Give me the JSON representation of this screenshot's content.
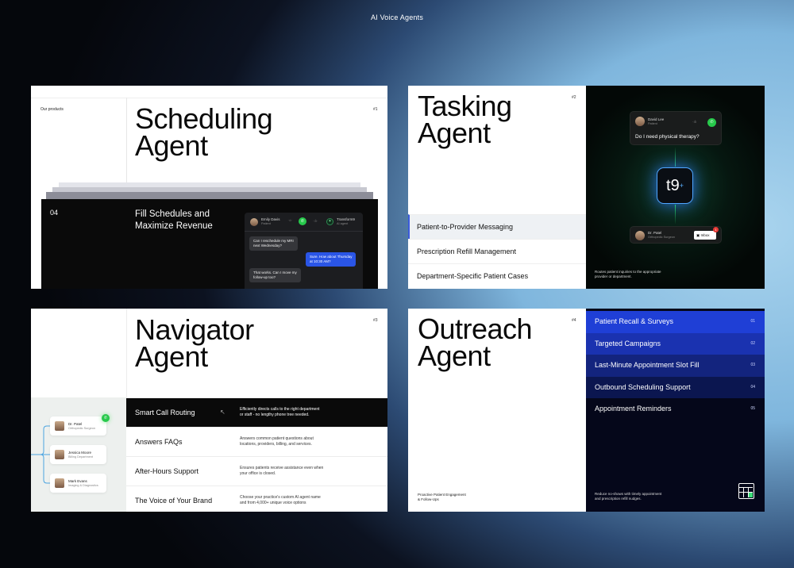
{
  "page": {
    "title": "AI Voice Agents"
  },
  "scheduling": {
    "label": "Our products",
    "num": "#1",
    "title_line1": "Scheduling",
    "title_line2": "Agent",
    "section_num": "04",
    "headline_line1": "Fill Schedules and",
    "headline_line2": "Maximize Revenue",
    "chat": {
      "caller_name": "Emily Davis",
      "caller_role": "Patient",
      "agent_name": "Transform9",
      "agent_role": "AI agent",
      "messages": [
        {
          "text_l1": "Can I reschedule my MRI",
          "text_l2": "next Wednesday?"
        },
        {
          "text_l1": "Sure. How about Thursday",
          "text_l2": "at 10:30 AM?"
        },
        {
          "text_l1": "That works. Can I move my",
          "text_l2": "follow-up too?"
        }
      ]
    }
  },
  "tasking": {
    "num": "#2",
    "title_line1": "Tasking",
    "title_line2": "Agent",
    "items": [
      {
        "label": "Patient-to-Provider Messaging"
      },
      {
        "label": "Prescription Refill Management"
      },
      {
        "label": "Department-Specific Patient Cases"
      }
    ],
    "top_chip": {
      "name": "David Lee",
      "role": "Patient",
      "question": "Do I need physical therapy?"
    },
    "logo": "t9",
    "bottom_chip": {
      "name": "Dr. Patel",
      "role": "Orthopedic Surgeon",
      "button": "Inbox",
      "badge": "1"
    },
    "footer_l1": "Routes patient inquiries to the appropriate",
    "footer_l2": "provider or department."
  },
  "navigator": {
    "num": "#3",
    "title_line1": "Navigator",
    "title_line2": "Agent",
    "contacts": [
      {
        "name": "Dr. Patel",
        "sub": "Orthopedic Surgeon"
      },
      {
        "name": "Jessica Moore",
        "sub": "Billing Department"
      },
      {
        "name": "Mark Evans",
        "sub": "Imaging & Diagnostics"
      }
    ],
    "rows": [
      {
        "label": "Smart Call Routing",
        "desc_l1": "Efficiently directs calls to the right department",
        "desc_l2": "or staff - no lengthy phone tree needed."
      },
      {
        "label": "Answers FAQs",
        "desc_l1": "Answers common patient questions about",
        "desc_l2": "locations, providers, billing, and services."
      },
      {
        "label": "After-Hours Support",
        "desc_l1": "Ensures patients receive assistance even when",
        "desc_l2": "your office is closed."
      },
      {
        "label": "The Voice of Your Brand",
        "desc_l1": "Choose your practice's custom AI agent name",
        "desc_l2": "and from 4,000+ unique voice options"
      }
    ]
  },
  "outreach": {
    "num": "#4",
    "title_line1": "Outreach",
    "title_line2": "Agent",
    "left_foot_l1": "Proactive Patient Engagement",
    "left_foot_l2": "& Follow-Ups",
    "items": [
      {
        "label": "Patient Recall & Surveys",
        "n": "01",
        "color": "#1f3fd6"
      },
      {
        "label": "Targeted Campaigns",
        "n": "02",
        "color": "#1a32b0"
      },
      {
        "label": "Last-Minute Appointment Slot Fill",
        "n": "03",
        "color": "#13247e"
      },
      {
        "label": "Outbound Scheduling Support",
        "n": "04",
        "color": "#0b1650"
      },
      {
        "label": "Appointment Reminders",
        "n": "05",
        "color": "#05071a"
      }
    ],
    "foot_l1": "Reduce no-shows with timely appointment",
    "foot_l2": "and prescription refill nudges."
  }
}
